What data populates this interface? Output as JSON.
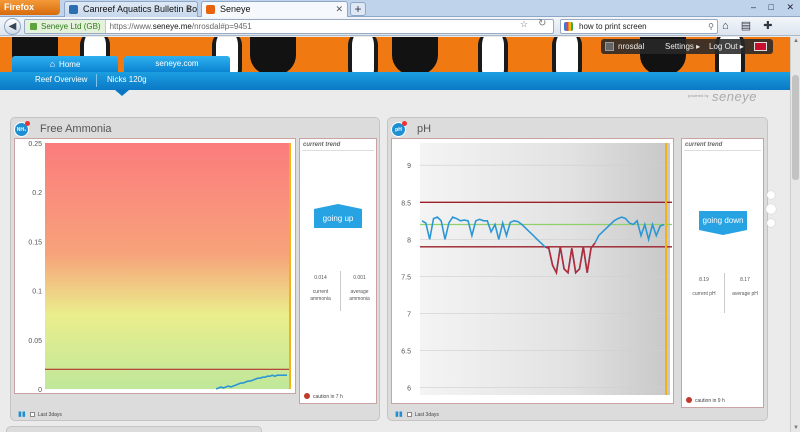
{
  "browser": {
    "menu_button": "Firefox",
    "tabs": [
      {
        "title": "Canreef Aquatics Bulletin Board - Rep..."
      },
      {
        "title": "Seneye"
      }
    ],
    "new_tab": "+",
    "window_controls": [
      "–",
      "□",
      "✕"
    ],
    "back_glyph": "◀",
    "site_identity": "Seneye Ltd (GB)",
    "url_prefix": "https://www.",
    "url_domain": "seneye.me",
    "url_path": "/nrosdal#p=9451",
    "search_value": "how to print screen",
    "toolbar_icons": [
      "home-icon",
      "bookmarks-icon",
      "addons-icon"
    ]
  },
  "site": {
    "user": {
      "name": "nrosdal",
      "settings": "Settings ▸",
      "logout": "Log Out ▸"
    },
    "main_tabs": [
      {
        "label": "Home",
        "icon": "home-icon"
      },
      {
        "label": "seneye.com"
      }
    ],
    "sub_nav": [
      "Reef Overview",
      "Nicks 120g"
    ],
    "powered_by": "powered by",
    "logo": "seneye"
  },
  "panels": {
    "ammonia": {
      "badge": "NH₃",
      "title": "Free Ammonia",
      "trend_header": "current trend",
      "trend_label": "going up",
      "stats": [
        {
          "value": "0.014",
          "label": "current ammonia"
        },
        {
          "value": "0.001",
          "label": "average ammonia"
        }
      ],
      "caution": "caution in 7 h",
      "footer": "Last 3days"
    },
    "ph": {
      "badge": "pH",
      "title": "pH",
      "trend_header": "current trend",
      "trend_label": "going down",
      "stats": [
        {
          "value": "8.19",
          "label": "current pH"
        },
        {
          "value": "8.17",
          "label": "average pH"
        }
      ],
      "caution": "caution in 9 h",
      "footer": "Last 3days"
    }
  },
  "chart_data": [
    {
      "type": "line",
      "title": "Free Ammonia",
      "ylim": [
        0,
        0.25
      ],
      "yticks": [
        "0",
        "0.05",
        "0.1",
        "0.15",
        "0.2",
        "0.25"
      ],
      "background": "gradient red (top) to yellow/green (bottom)",
      "threshold": 0.02,
      "series": [
        {
          "values": [
            0,
            0,
            0,
            0,
            0,
            0,
            0,
            0,
            0,
            0,
            0,
            0,
            0,
            0,
            0,
            0,
            0,
            0,
            0,
            0,
            0,
            0,
            0,
            0,
            0,
            0,
            0,
            0,
            0,
            0,
            0,
            0,
            0,
            0,
            0,
            0,
            0,
            0,
            0,
            0,
            0,
            0,
            0,
            0,
            0,
            0,
            0,
            0,
            0,
            0,
            0,
            0,
            0,
            0,
            0,
            0,
            0,
            0,
            0,
            0,
            0,
            0,
            0,
            0,
            0,
            0,
            0,
            0,
            0,
            0,
            0,
            0.001,
            0.002,
            0.001,
            0.002,
            0.003,
            0.002,
            0.003,
            0.004,
            0.005,
            0.006,
            0.006,
            0.007,
            0.008,
            0.008,
            0.009,
            0.01,
            0.011,
            0.011,
            0.012,
            0.012,
            0.013,
            0.013,
            0.014,
            0.013,
            0.014,
            0.014,
            0.014,
            0.014,
            0.014
          ]
        }
      ],
      "grid": false
    },
    {
      "type": "line",
      "title": "pH",
      "ylim": [
        5.9,
        9.3
      ],
      "yticks": [
        "6",
        "6.5",
        "7",
        "7.5",
        "8",
        "8.5",
        "9"
      ],
      "upper_limit": 8.5,
      "lower_limit": 7.9,
      "target": 8.2,
      "series": [
        {
          "values": [
            8.25,
            8.22,
            8.0,
            8.28,
            8.3,
            8.25,
            8.0,
            8.22,
            8.3,
            8.28,
            8.25,
            8.26,
            8.25,
            8.05,
            8.25,
            8.27,
            8.25,
            8.25,
            8.1,
            8.2,
            8.0,
            8.22,
            8.05,
            8.23,
            8.25,
            8.24,
            8.2,
            8.15,
            8.1,
            8.05,
            8.0,
            7.95,
            7.9,
            7.88,
            7.65,
            7.55,
            7.9,
            7.6,
            7.55,
            7.88,
            7.55,
            7.6,
            7.9,
            7.55,
            7.88,
            7.95,
            8.05,
            8.1,
            8.15,
            8.2,
            8.25,
            8.28,
            8.3,
            8.28,
            8.22,
            8.2,
            8.25,
            8.05,
            8.2,
            8.0,
            8.2,
            8.05,
            8.18,
            8.2
          ]
        }
      ],
      "grid": true
    }
  ]
}
